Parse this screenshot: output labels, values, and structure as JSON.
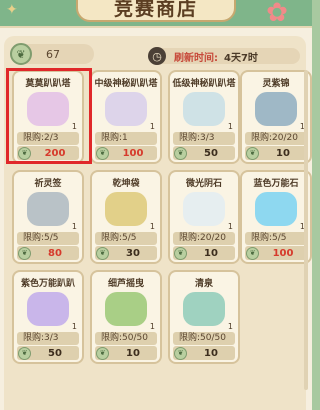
{
  "header": {
    "title": "竞赛商店"
  },
  "currency": {
    "icon": "leaf-token-icon",
    "amount": "67"
  },
  "refresh": {
    "label": "刷新时间:",
    "value": "4天7时"
  },
  "items": [
    {
      "name": "莫莫趴趴塔",
      "qty": "1",
      "limit": "限购:2/3",
      "price": "200",
      "price_red": true,
      "color": "#e6c7e6"
    },
    {
      "name": "中级神秘趴趴塔",
      "qty": "1",
      "limit": "限购:1",
      "price": "100",
      "price_red": true,
      "color": "#ddd4ea"
    },
    {
      "name": "低级神秘趴趴塔",
      "qty": "1",
      "limit": "限购:3/3",
      "price": "50",
      "price_red": false,
      "color": "#cfe2e6"
    },
    {
      "name": "灵紫锦",
      "qty": "1",
      "limit": "限购:20/20",
      "price": "10",
      "price_red": false,
      "color": "#9fb8c6"
    },
    {
      "name": "祈灵签",
      "qty": "1",
      "limit": "限购:5/5",
      "price": "80",
      "price_red": true,
      "color": "#b9c2c7"
    },
    {
      "name": "乾坤袋",
      "qty": "1",
      "limit": "限购:5/5",
      "price": "30",
      "price_red": false,
      "color": "#e2d089"
    },
    {
      "name": "微光阴石",
      "qty": "1",
      "limit": "限购:20/20",
      "price": "10",
      "price_red": false,
      "color": "#e6eef0"
    },
    {
      "name": "蓝色万能石",
      "qty": "1",
      "limit": "限购:5/5",
      "price": "100",
      "price_red": true,
      "color": "#8ed8f0"
    },
    {
      "name": "紫色万能趴趴",
      "qty": "1",
      "limit": "限购:3/3",
      "price": "50",
      "price_red": false,
      "color": "#c9b6ea"
    },
    {
      "name": "细芦摇曳",
      "qty": "1",
      "limit": "限购:50/50",
      "price": "10",
      "price_red": false,
      "color": "#a9cf86"
    },
    {
      "name": "清泉",
      "qty": "1",
      "limit": "限购:50/50",
      "price": "10",
      "price_red": false,
      "color": "#9fd2c0"
    }
  ]
}
